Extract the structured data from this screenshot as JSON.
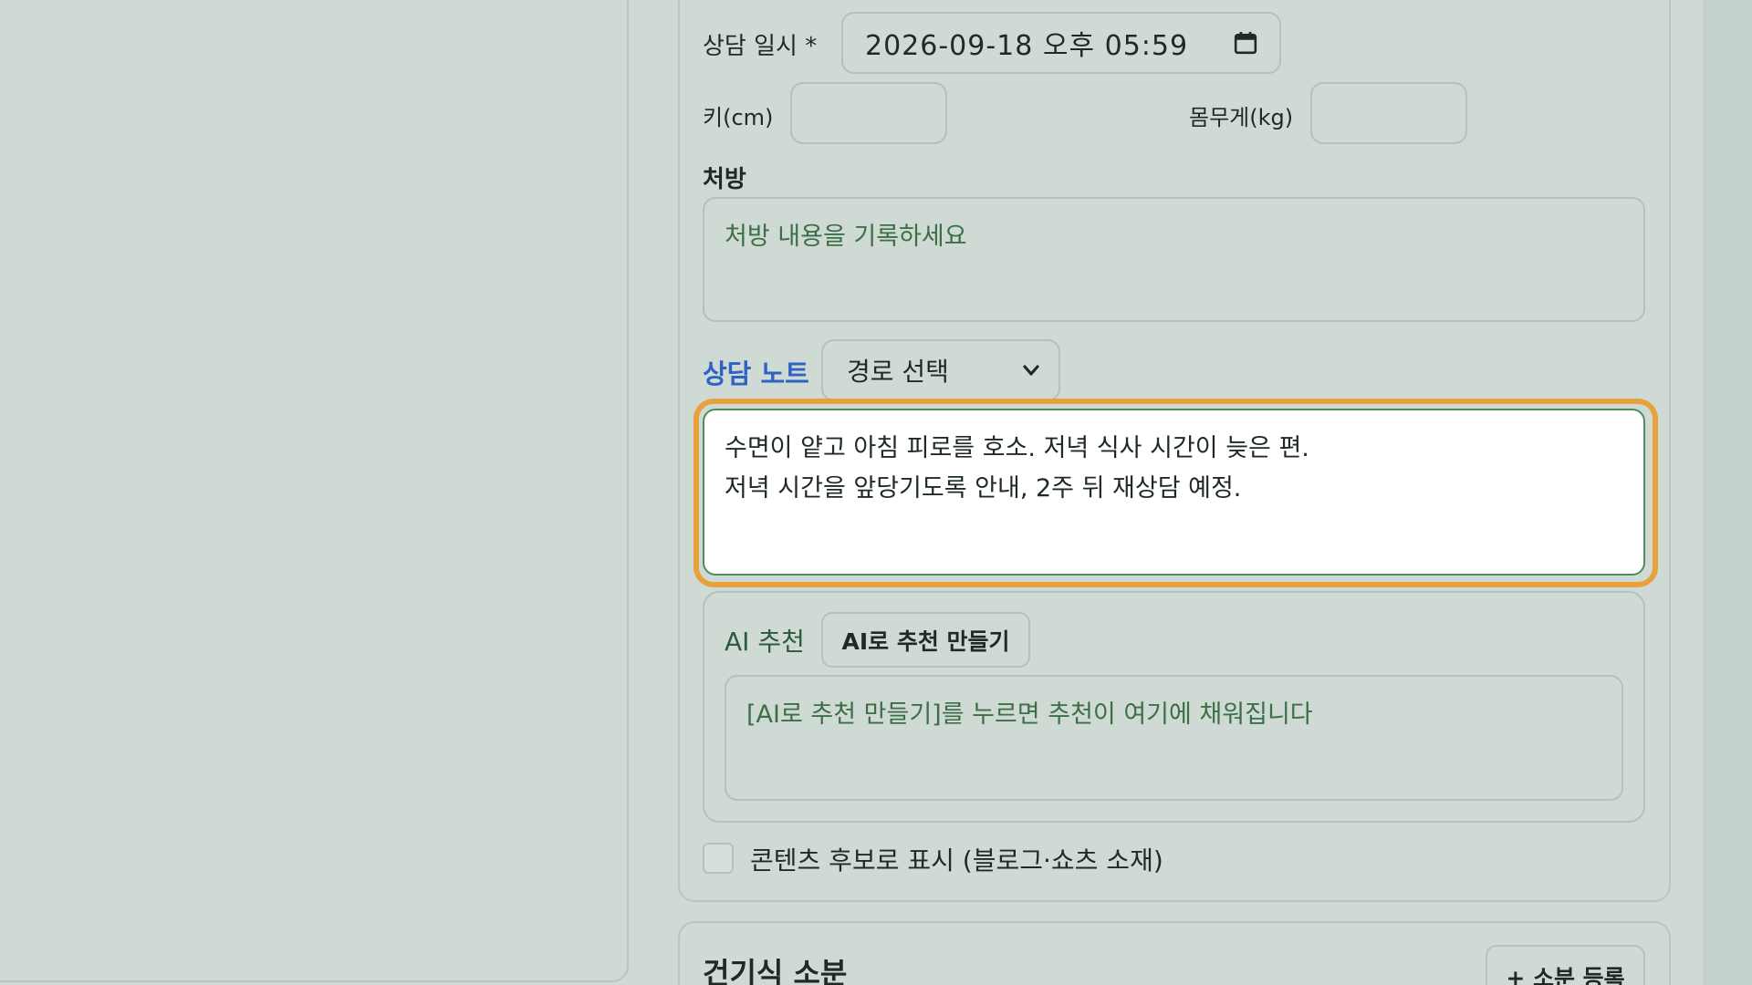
{
  "consult_datetime": {
    "label": "상담 일시 *",
    "value": "2026-09-18 오후 05:59"
  },
  "height": {
    "label": "키(cm)",
    "value": ""
  },
  "weight": {
    "label": "몸무게(kg)",
    "value": ""
  },
  "prescription": {
    "label": "처방",
    "placeholder": "처방 내용을 기록하세요"
  },
  "consult_note": {
    "label": "상담 노트",
    "route_select": "경로 선택",
    "value": "수면이 얕고 아침 피로를 호소. 저녁 식사 시간이 늦은 편.\n저녁 시간을 앞당기도록 안내, 2주 뒤 재상담 예정."
  },
  "ai_recommendation": {
    "label": "AI 추천",
    "button": "AI로 추천 만들기",
    "placeholder": "[AI로 추천 만들기]를 누르면 추천이 여기에 채워집니다"
  },
  "content_candidate": {
    "label": "콘텐츠 후보로 표시 (블로그·쇼츠 소재)",
    "checked": false
  },
  "supplement_section": {
    "title": "건기식 소분",
    "add_button": "+ 소분 등록"
  },
  "colors": {
    "background": "#cfdad5",
    "accent_focus": "#e7a23e",
    "section_title": "#2e62c4",
    "placeholder": "#3c6f45"
  }
}
